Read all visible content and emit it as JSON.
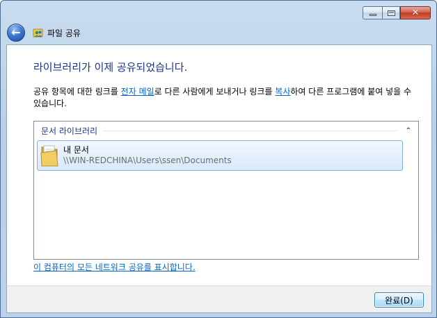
{
  "window": {
    "title": "파일 공유",
    "colors": {
      "accent": "#1e3287",
      "link": "#0066cc",
      "close": "#c23a23"
    }
  },
  "icons": {
    "back": "back-arrow-icon",
    "app": "file-sharing-icon",
    "folder": "folder-icon"
  },
  "main": {
    "heading": "라이브러리가 이제 공유되었습니다.",
    "description": {
      "part1": "공유 항목에 대한 링크를 ",
      "email_link": "전자 메일",
      "part2": "로 다른 사람에게 보내거나 링크를 ",
      "copy_link": "복사",
      "part3": "하여 다른 프로그램에 붙여 넣을 수 있습니다."
    },
    "group": {
      "title": "문서 라이브러리",
      "items": [
        {
          "name": "내 문서",
          "path": "\\\\WIN-REDCHINA\\Users\\ssen\\Documents"
        }
      ]
    },
    "network_link": "이 컴퓨터의 모든 네트워크 공유를 표시합니다."
  },
  "footer": {
    "finish_label": "완료(D)"
  }
}
